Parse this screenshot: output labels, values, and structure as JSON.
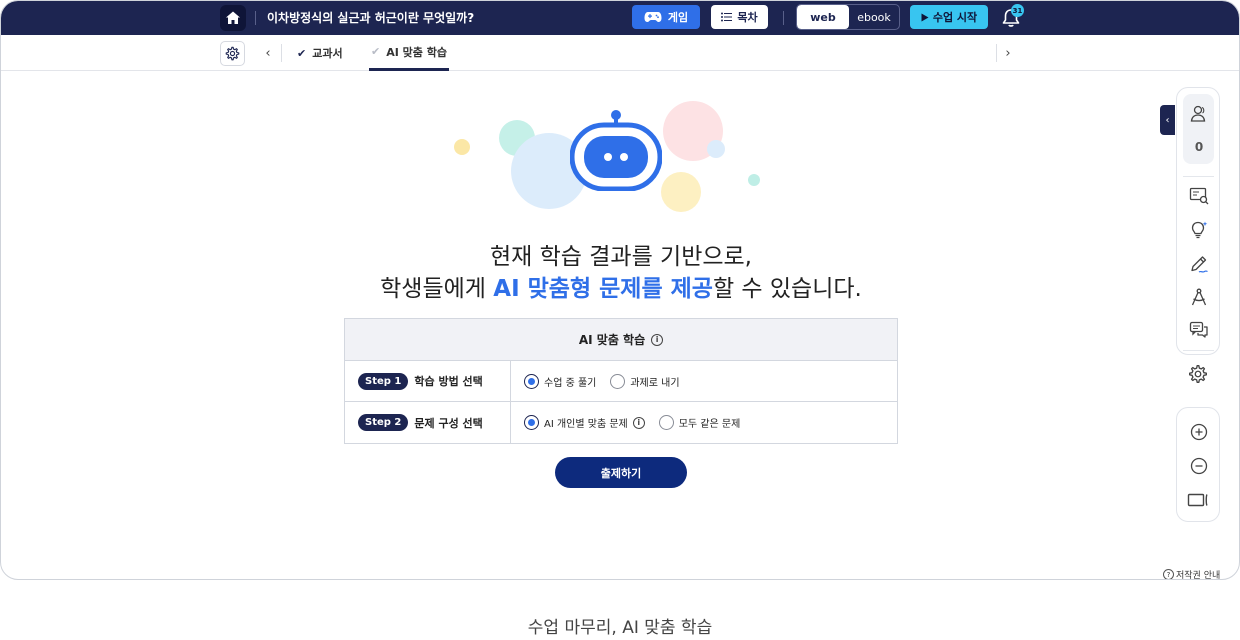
{
  "topbar": {
    "lesson_title": "이차방정식의 실근과 허근이란 무엇일까?",
    "game_label": "게임",
    "toc_label": "목차",
    "view_web": "web",
    "view_ebook": "ebook",
    "start_label": "수업 시작",
    "notification_count": "31"
  },
  "subnav": {
    "tab_textbook": "교과서",
    "tab_ai": "AI 맞춤 학습"
  },
  "hero": {
    "line1": "현재 학습 결과를 기반으로,",
    "line2_prefix": "학생들에게 ",
    "line2_highlight": "AI 맞춤형 문제를 제공",
    "line2_suffix": "할 수 있습니다."
  },
  "card": {
    "title": "AI 맞춤 학습",
    "rows": [
      {
        "step": "Step 1",
        "label": "학습 방법 선택",
        "options": [
          "수업 중 풀기",
          "과제로 내기"
        ],
        "selected": "수업 중 풀기"
      },
      {
        "step": "Step 2",
        "label": "문제 구성 선택",
        "options": [
          "AI 개인별 맞춤 문제",
          "모두 같은 문제"
        ],
        "selected": "AI 개인별 맞춤 문제"
      }
    ]
  },
  "submit_label": "출제하기",
  "rail": {
    "participant_count": "0"
  },
  "copyright_label": "저작권 안내",
  "caption": "수업 마무리, AI 맞춤 학습",
  "colors": {
    "navy": "#1d2551",
    "accent_blue": "#2f6fe8",
    "cyan": "#38c5f0",
    "submit": "#0d2a7d"
  }
}
